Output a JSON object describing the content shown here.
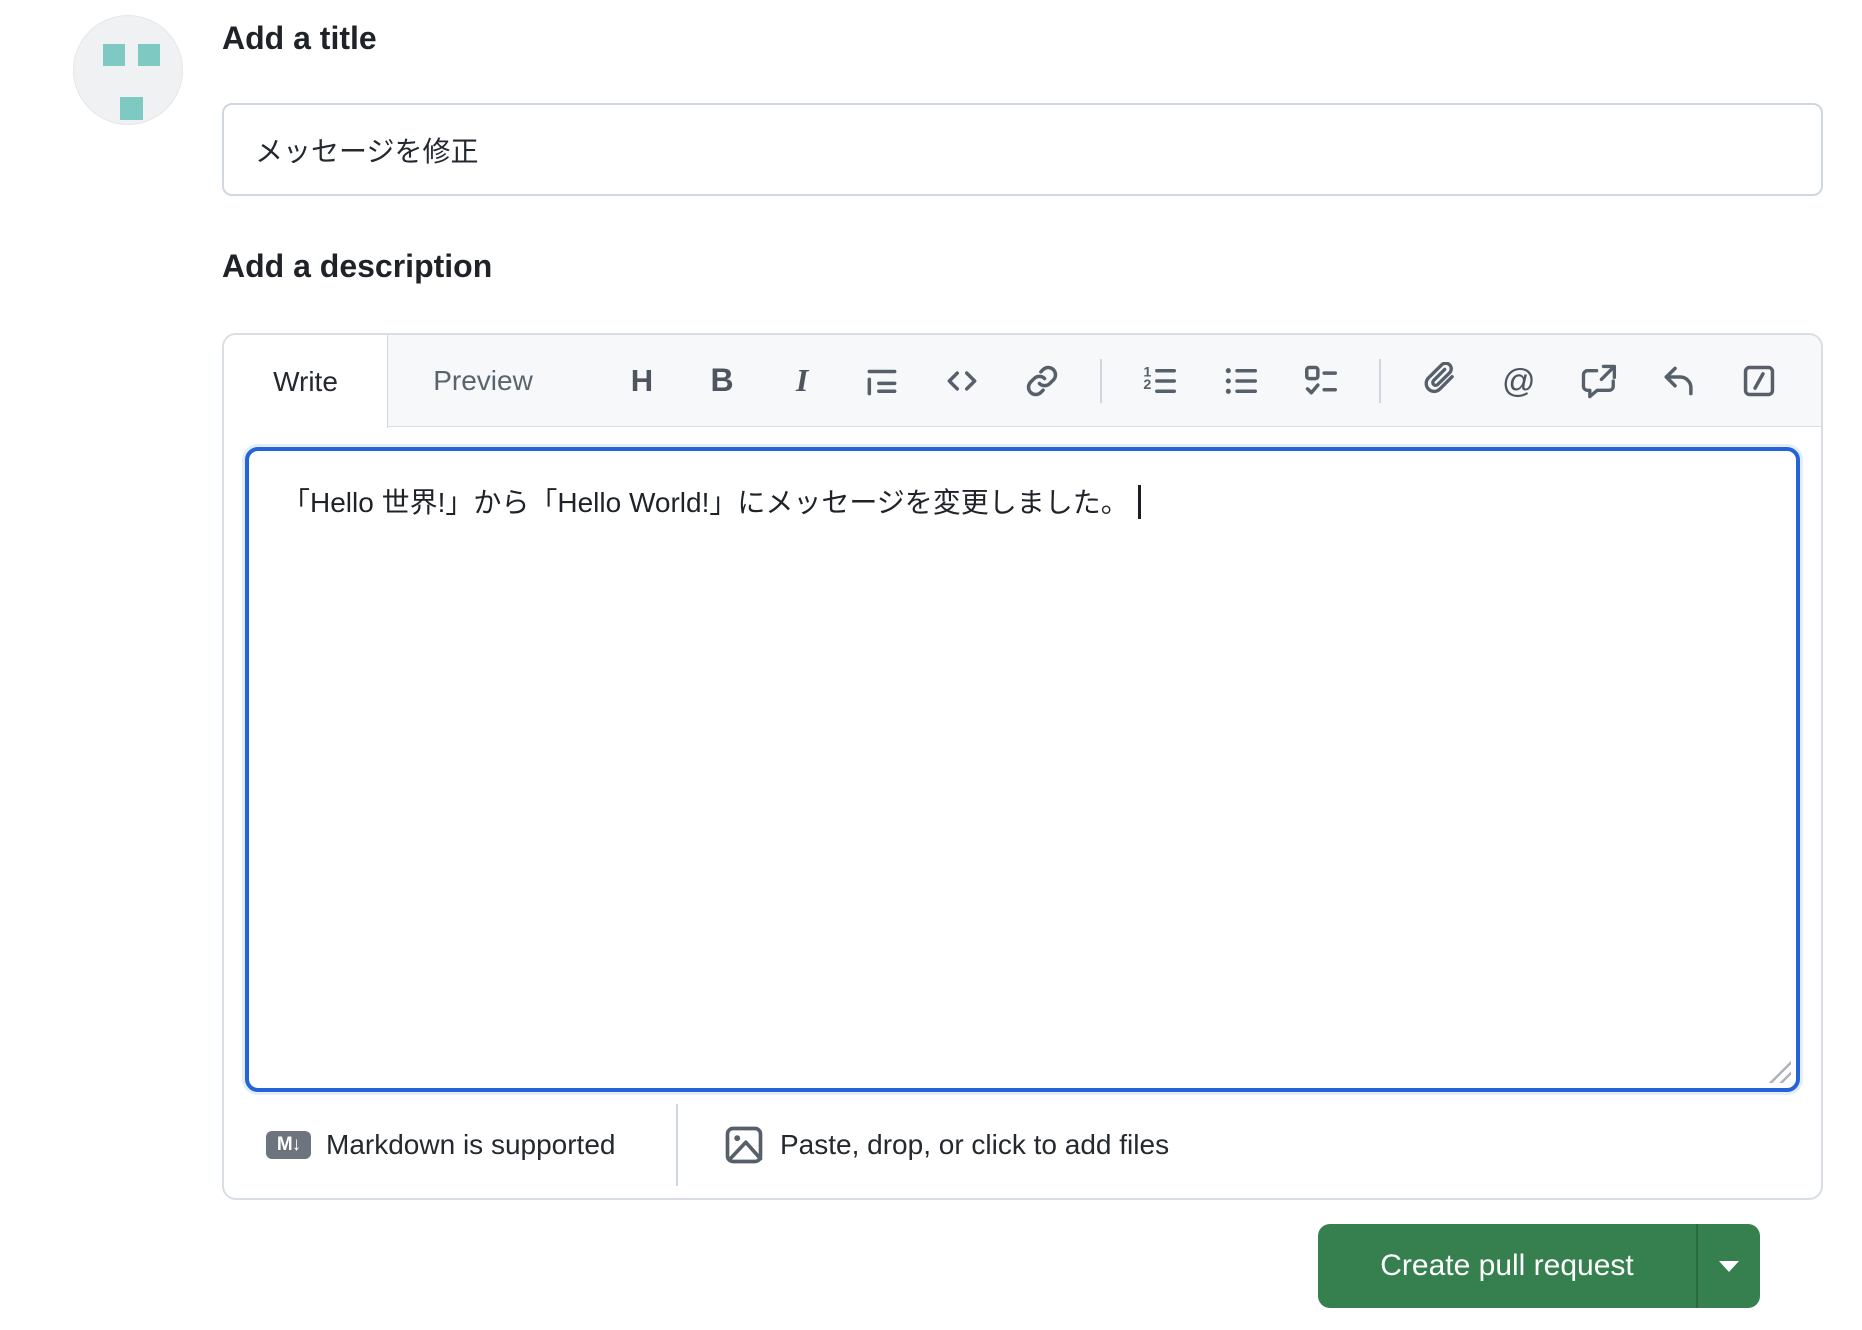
{
  "avatar": {
    "type": "identicon",
    "square_color": "#7ecac3",
    "bg": "#f0f1f3"
  },
  "title_section": {
    "label": "Add a title",
    "value": "メッセージを修正"
  },
  "description_section": {
    "label": "Add a description",
    "tabs": {
      "write": "Write",
      "preview": "Preview"
    },
    "toolbar": {
      "heading_glyph": "H",
      "bold_glyph": "B",
      "italic_glyph": "I",
      "mention_glyph": "@",
      "icon_names": [
        "heading",
        "bold",
        "italic",
        "quote",
        "code",
        "link",
        "list-ordered",
        "list-unordered",
        "tasklist",
        "attach-file",
        "mention",
        "cross-reference",
        "reply",
        "saved-replies"
      ]
    },
    "body_text": "「Hello 世界!」から「Hello World!」にメッセージを変更しました。",
    "footer": {
      "markdown_badge": "M↓",
      "markdown_hint": "Markdown is supported",
      "attach_hint": "Paste, drop, or click to add files"
    }
  },
  "actions": {
    "create_label": "Create pull request"
  },
  "colors": {
    "button_green": "#35804e",
    "focus_blue": "#2365d9",
    "header_bg": "#f6f8fa",
    "border": "#d0d7de",
    "icon_gray": "#57606a",
    "identicon_teal": "#7ecac3"
  }
}
